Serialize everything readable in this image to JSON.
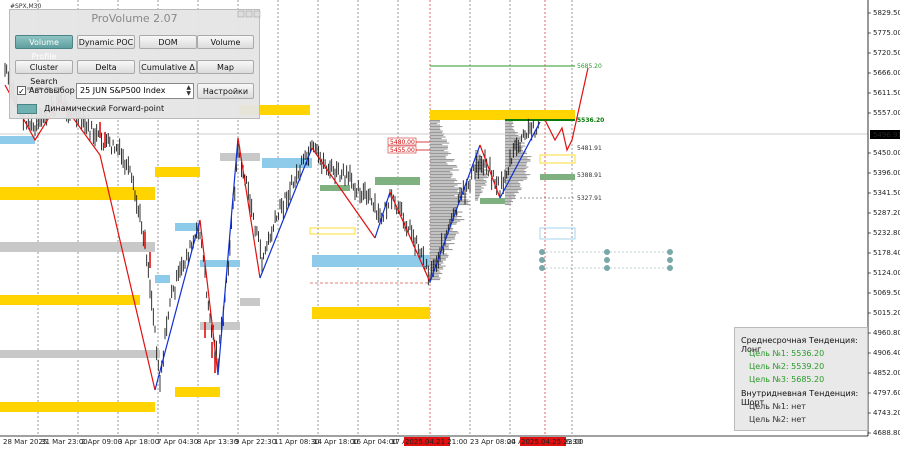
{
  "symbol": "#SPX,M30",
  "panel": {
    "title": "ProVolume 2.07",
    "buttons": [
      {
        "label": "Volume Profile",
        "active": true
      },
      {
        "label": "Dynamic POC",
        "active": false
      },
      {
        "label": "DOM",
        "active": false
      },
      {
        "label": "Volume",
        "active": false
      },
      {
        "label": "Cluster Search",
        "active": false
      },
      {
        "label": "Delta",
        "active": false
      },
      {
        "label": "Cumulative Δ",
        "active": false
      },
      {
        "label": "Map",
        "active": false
      }
    ],
    "auto_label": "Автовыбор",
    "auto_checked": "✓",
    "instrument": "25 JUN S&P500 Index",
    "settings_label": "Настройки",
    "forward_label": "Динамический Forward-point"
  },
  "price_axis": [
    "5829.50",
    "5775.00",
    "5720.50",
    "5666.00",
    "5611.50",
    "5557.00",
    "5450.00",
    "5396.00",
    "5341.50",
    "5287.20",
    "5232.80",
    "5178.40",
    "5124.00",
    "5069.50",
    "5015.20",
    "4960.80",
    "4906.40",
    "4852.00",
    "4797.60",
    "4743.20",
    "4688.80"
  ],
  "current_price": "5496.91",
  "time_axis": [
    "28 Mar 2025",
    "31 Mar 23:00",
    "2 Apr 09:00",
    "3 Apr 18:00",
    "7 Apr 04:30",
    "8 Apr 13:30",
    "9 Apr 22:30",
    "11 Apr 08:30",
    "14 Apr 18:00",
    "16 Apr 04:00",
    "17 Ap",
    "2025.04.21 21:00",
    "23 Apr 08:00",
    "24 A",
    "2025.04.25 23:00",
    "6:30"
  ],
  "level_tags": [
    {
      "text": "5685.20",
      "color": "#2a9a2a"
    },
    {
      "text": "5536.20",
      "color": "#0a7a0a"
    },
    {
      "text": "5481.91",
      "color": "#333"
    },
    {
      "text": "5388.91",
      "color": "#333"
    },
    {
      "text": "5327.91",
      "color": "#333"
    },
    {
      "text": "5480.00",
      "color": "#c00"
    },
    {
      "text": "5455.00",
      "color": "#c00"
    }
  ],
  "trend": {
    "mid_title": "Среднесрочная Тенденция: Лонг",
    "mid_targets": [
      "Цель №1: 5536.20",
      "Цель №2: 5539.20",
      "Цель №3: 5685.20"
    ],
    "intra_title": "Внутридневная Тенденция: Шорт",
    "intra_targets": [
      "Цель №1: нет",
      "Цель №2: нет"
    ]
  },
  "colors": {
    "gold": "#ffd400",
    "blue_zone": "#8ecbea",
    "gray_zone": "#c8c8c8",
    "green_zone": "#7fb07f",
    "up_zigzag": "#1030d0",
    "down_zigzag": "#e01010",
    "candles": "#000000"
  }
}
